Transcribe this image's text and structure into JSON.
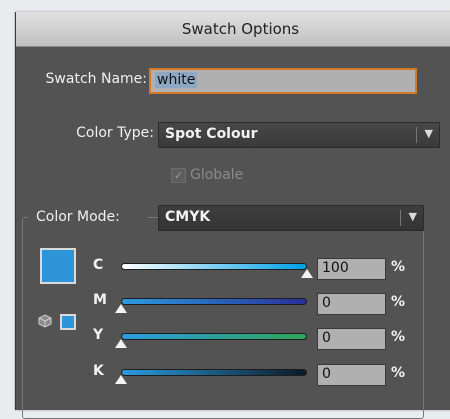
{
  "dialog": {
    "title": "Swatch Options"
  },
  "swatch_name": {
    "label": "Swatch Name:",
    "value": "white"
  },
  "color_type": {
    "label": "Color Type:",
    "value": "Spot Colour"
  },
  "globale": {
    "label": "Globale",
    "checked": true
  },
  "color_mode": {
    "label": "Color Mode:",
    "value": "CMYK"
  },
  "swatch_color": "#2e94d8",
  "channels": [
    {
      "letter": "C",
      "value": "100",
      "unit": "%",
      "level": 1.0,
      "gradient": [
        "#ffffff",
        "#00a0e6"
      ]
    },
    {
      "letter": "M",
      "value": "0",
      "unit": "%",
      "level": 0.0,
      "gradient": [
        "#2b9be0",
        "#2a2f9c"
      ]
    },
    {
      "letter": "Y",
      "value": "0",
      "unit": "%",
      "level": 0.0,
      "gradient": [
        "#2b9be0",
        "#2fa558"
      ]
    },
    {
      "letter": "K",
      "value": "0",
      "unit": "%",
      "level": 0.0,
      "gradient": [
        "#2b9be0",
        "#0b1a26"
      ]
    }
  ]
}
